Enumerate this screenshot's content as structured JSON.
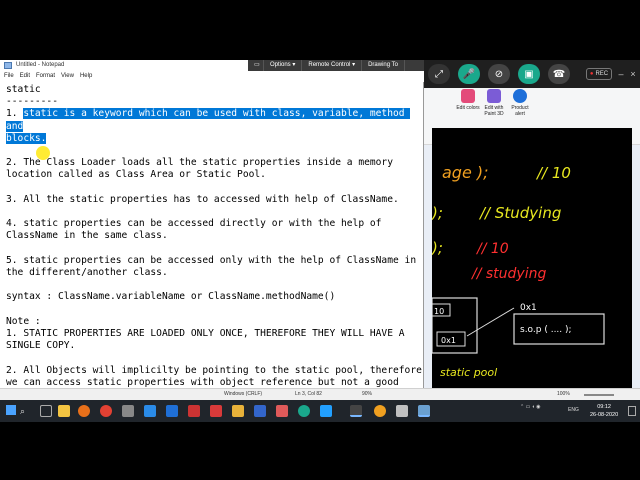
{
  "notepad": {
    "title": "Untitled - Notepad",
    "menu": [
      "File",
      "Edit",
      "Format",
      "View",
      "Help"
    ],
    "lines": [
      {
        "text": "static",
        "selected": ""
      },
      {
        "text": "---------",
        "selected": ""
      },
      {
        "prefix": "1. ",
        "selected": "static is a keyword which can be used with class, variable, method and",
        "text": ""
      },
      {
        "selected": "blocks.",
        "text": ""
      },
      {
        "text": "",
        "selected": ""
      },
      {
        "text": "2. The Class Loader loads all the static properties inside a memory",
        "selected": ""
      },
      {
        "text": "location called as Class Area or Static Pool.",
        "selected": ""
      },
      {
        "text": "",
        "selected": ""
      },
      {
        "text": "3. All the static properties has to accessed with help of ClassName.",
        "selected": ""
      },
      {
        "text": "",
        "selected": ""
      },
      {
        "text": "4. static properties can be accessed directly or with the help of",
        "selected": ""
      },
      {
        "text": "ClassName in the same class.",
        "selected": ""
      },
      {
        "text": "",
        "selected": ""
      },
      {
        "text": "5. static properties can be accessed only with the help of ClassName in",
        "selected": ""
      },
      {
        "text": "the different/another class.",
        "selected": ""
      },
      {
        "text": "",
        "selected": ""
      },
      {
        "text": "syntax : ClassName.variableName or ClassName.methodName()",
        "selected": ""
      },
      {
        "text": "",
        "selected": ""
      },
      {
        "text": "Note :",
        "selected": ""
      },
      {
        "text": "1. STATIC PROPERTIES ARE LOADED ONLY ONCE, THEREFORE THEY WILL HAVE A",
        "selected": ""
      },
      {
        "text": "SINGLE COPY.",
        "selected": ""
      },
      {
        "text": "",
        "selected": ""
      },
      {
        "text": "2. All Objects will implicilty be pointing to the static pool, therefore",
        "selected": ""
      },
      {
        "text": "we can access static properties with object reference but not a good",
        "selected": ""
      },
      {
        "text": "practice.",
        "selected": ""
      }
    ],
    "status": {
      "line_ending": "Windows (CRLF)",
      "position": "Ln 3, Col 82",
      "zoom": "90%"
    }
  },
  "remote_toolbar": {
    "items": [
      "Options",
      "Remote Control",
      "Drawing To"
    ]
  },
  "paint": {
    "ribbon": [
      {
        "label": "Edit colors",
        "color": "#e34b7a"
      },
      {
        "label": "Edit with Paint 3D",
        "color": "#7b5cd6"
      },
      {
        "label": "Product alert",
        "color": "#1e6fd9"
      }
    ],
    "status_zoom": "100%",
    "canvas_text": [
      {
        "text": "age );",
        "color": "#f0a020"
      },
      {
        "text": "// 10",
        "color": "#e8e820"
      },
      {
        "text": ");",
        "color": "#e8e820"
      },
      {
        "text": "// Studying",
        "color": "#e8e820"
      },
      {
        "text": ");",
        "color": "#e8e820"
      },
      {
        "text": "// 10",
        "color": "#ff3030"
      },
      {
        "text": "// studying",
        "color": "#ff3030"
      },
      {
        "text": "0x1",
        "color": "#ffffff"
      },
      {
        "text": "10",
        "color": "#ffffff"
      },
      {
        "text": "0x1",
        "color": "#ffffff"
      },
      {
        "text": "s.o.p ( .... );",
        "color": "#ffffff"
      },
      {
        "text": "static pool",
        "color": "#e8e820"
      }
    ]
  },
  "meeting": {
    "rec_label": "REC"
  },
  "taskbar": {
    "lang": "ENG",
    "time": "09:12",
    "date": "26-08-2020"
  }
}
